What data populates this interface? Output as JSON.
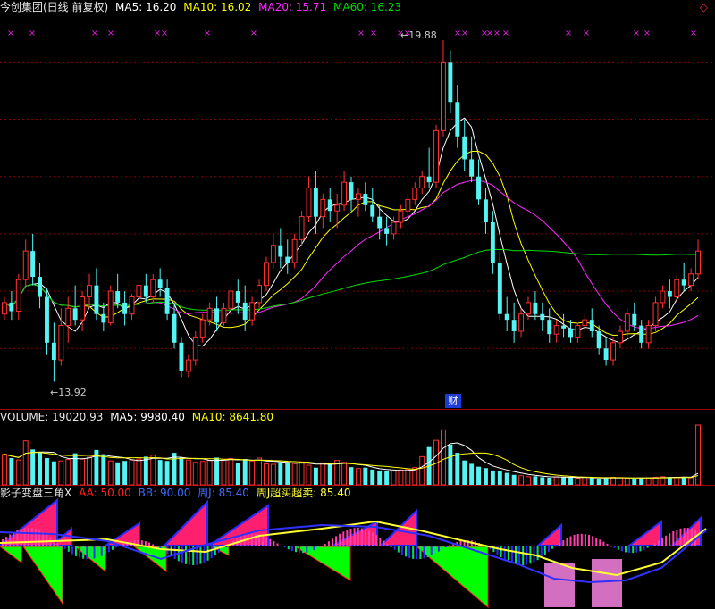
{
  "header_main": {
    "title": "今创集团(日线 前复权)",
    "ma5": "MA5: 16.20",
    "ma10": "MA10: 16.02",
    "ma20": "MA20: 15.71",
    "ma60": "MA60: 16.23",
    "corner_icon": "◇"
  },
  "header_volume": {
    "label": "VOLUME: 19020.93",
    "ma5": "MA5: 9980.40",
    "ma10": "MA10: 8641.80"
  },
  "header_indicator": {
    "title": "影子变盘三角X",
    "aa": "AA: 50.00",
    "bb": "BB: 90.00",
    "zhouj": "周J: 85.40",
    "zhouj_cm": "周J超买超卖: 85.40"
  },
  "annotations": {
    "high": "←19.88",
    "low": "←13.92",
    "cai": "财"
  },
  "colors": {
    "up": "#ff3030",
    "down": "#54f4f4",
    "ma5": "#ffffff",
    "ma10": "#ffff00",
    "ma20": "#ff28ff",
    "ma60": "#00dd00",
    "grid": "#8b0000",
    "tri_pos": "#ff1f6f",
    "tri_neg": "#00ff00",
    "zhouj_line": "#ffff33",
    "blue_line": "#3030ff",
    "pink_box": "#d36fc0"
  },
  "chart_data": [
    {
      "type": "candlestick",
      "title": "今创集团(日线 前复权)",
      "ylim": [
        13.6,
        20.3
      ],
      "gridlines": [
        19.5,
        18.5,
        17.5,
        16.5,
        15.5,
        14.5
      ],
      "high_label": 19.88,
      "low_label": 13.92,
      "ohlc": [
        [
          15.1,
          15.4,
          15.0,
          15.3
        ],
        [
          15.3,
          15.5,
          15.0,
          15.15
        ],
        [
          15.15,
          15.8,
          15.0,
          15.7
        ],
        [
          15.7,
          16.4,
          15.6,
          16.2
        ],
        [
          16.2,
          16.5,
          15.6,
          15.75
        ],
        [
          15.75,
          16.0,
          15.2,
          15.4
        ],
        [
          15.4,
          15.55,
          14.4,
          14.6
        ],
        [
          14.6,
          14.95,
          13.92,
          14.3
        ],
        [
          14.3,
          15.2,
          14.2,
          14.9
        ],
        [
          14.9,
          15.4,
          14.6,
          15.2
        ],
        [
          15.2,
          15.6,
          14.9,
          15.0
        ],
        [
          15.0,
          15.5,
          14.8,
          15.4
        ],
        [
          15.4,
          15.8,
          15.2,
          15.6
        ],
        [
          15.6,
          15.9,
          15.0,
          15.1
        ],
        [
          15.1,
          15.3,
          14.8,
          14.95
        ],
        [
          14.95,
          15.6,
          14.9,
          15.5
        ],
        [
          15.5,
          15.8,
          15.2,
          15.3
        ],
        [
          15.3,
          15.5,
          14.9,
          15.1
        ],
        [
          15.1,
          15.45,
          15.0,
          15.4
        ],
        [
          15.4,
          15.7,
          15.3,
          15.6
        ],
        [
          15.6,
          15.8,
          15.3,
          15.4
        ],
        [
          15.4,
          15.8,
          15.3,
          15.7
        ],
        [
          15.7,
          15.9,
          15.4,
          15.55
        ],
        [
          15.55,
          15.7,
          15.0,
          15.1
        ],
        [
          15.1,
          15.3,
          14.5,
          14.6
        ],
        [
          14.6,
          14.7,
          14.0,
          14.1
        ],
        [
          14.1,
          14.4,
          14.0,
          14.3
        ],
        [
          14.3,
          14.8,
          14.2,
          14.7
        ],
        [
          14.7,
          15.1,
          14.6,
          15.0
        ],
        [
          15.0,
          15.3,
          14.9,
          15.2
        ],
        [
          15.2,
          15.4,
          14.8,
          14.95
        ],
        [
          14.95,
          15.3,
          14.9,
          15.2
        ],
        [
          15.2,
          15.6,
          15.1,
          15.5
        ],
        [
          15.5,
          15.7,
          15.1,
          15.3
        ],
        [
          15.3,
          15.6,
          14.8,
          15.0
        ],
        [
          15.0,
          15.4,
          14.9,
          15.3
        ],
        [
          15.3,
          15.7,
          15.2,
          15.6
        ],
        [
          15.6,
          16.1,
          15.5,
          16.0
        ],
        [
          16.0,
          16.5,
          15.9,
          16.3
        ],
        [
          16.3,
          16.6,
          15.9,
          16.1
        ],
        [
          16.1,
          16.4,
          15.8,
          16.0
        ],
        [
          16.0,
          16.5,
          15.9,
          16.4
        ],
        [
          16.4,
          16.9,
          16.3,
          16.8
        ],
        [
          16.8,
          17.5,
          16.7,
          17.3
        ],
        [
          17.3,
          17.6,
          16.5,
          16.8
        ],
        [
          16.8,
          17.2,
          16.6,
          17.1
        ],
        [
          17.1,
          17.3,
          16.7,
          16.9
        ],
        [
          16.9,
          17.2,
          16.6,
          17.0
        ],
        [
          17.0,
          17.6,
          16.9,
          17.4
        ],
        [
          17.4,
          17.5,
          16.9,
          17.1
        ],
        [
          17.1,
          17.3,
          16.8,
          17.2
        ],
        [
          17.2,
          17.4,
          16.9,
          17.0
        ],
        [
          17.0,
          17.3,
          16.7,
          16.8
        ],
        [
          16.8,
          17.0,
          16.4,
          16.6
        ],
        [
          16.6,
          16.8,
          16.3,
          16.5
        ],
        [
          16.5,
          16.8,
          16.4,
          16.7
        ],
        [
          16.7,
          17.0,
          16.6,
          16.9
        ],
        [
          16.9,
          17.2,
          16.8,
          17.1
        ],
        [
          17.1,
          17.4,
          17.0,
          17.3
        ],
        [
          17.3,
          17.6,
          17.2,
          17.5
        ],
        [
          17.5,
          18.0,
          17.3,
          17.4
        ],
        [
          17.4,
          18.4,
          17.3,
          18.3
        ],
        [
          18.3,
          19.88,
          18.2,
          19.5
        ],
        [
          19.5,
          19.7,
          18.6,
          18.8
        ],
        [
          18.8,
          19.1,
          18.0,
          18.2
        ],
        [
          18.2,
          18.5,
          17.6,
          17.8
        ],
        [
          17.8,
          18.2,
          17.4,
          17.5
        ],
        [
          17.5,
          17.8,
          17.0,
          17.1
        ],
        [
          17.1,
          17.3,
          16.5,
          16.7
        ],
        [
          16.7,
          16.9,
          15.8,
          16.0
        ],
        [
          16.0,
          16.2,
          15.0,
          15.1
        ],
        [
          15.1,
          15.4,
          14.8,
          15.0
        ],
        [
          15.0,
          15.3,
          14.6,
          14.8
        ],
        [
          14.8,
          15.2,
          14.7,
          15.1
        ],
        [
          15.1,
          15.4,
          15.0,
          15.3
        ],
        [
          15.3,
          15.5,
          15.0,
          15.1
        ],
        [
          15.1,
          15.3,
          14.8,
          15.0
        ],
        [
          15.0,
          15.2,
          14.6,
          14.75
        ],
        [
          14.75,
          15.0,
          14.6,
          14.9
        ],
        [
          14.9,
          15.1,
          14.7,
          14.85
        ],
        [
          14.85,
          15.0,
          14.6,
          14.7
        ],
        [
          14.7,
          14.95,
          14.6,
          14.9
        ],
        [
          14.9,
          15.1,
          14.8,
          15.0
        ],
        [
          15.0,
          15.2,
          14.7,
          14.8
        ],
        [
          14.8,
          14.9,
          14.4,
          14.5
        ],
        [
          14.5,
          14.7,
          14.2,
          14.3
        ],
        [
          14.3,
          14.7,
          14.2,
          14.6
        ],
        [
          14.6,
          14.9,
          14.5,
          14.8
        ],
        [
          14.8,
          15.2,
          14.7,
          15.1
        ],
        [
          15.1,
          15.3,
          14.8,
          14.9
        ],
        [
          14.9,
          15.0,
          14.5,
          14.6
        ],
        [
          14.6,
          15.0,
          14.5,
          14.9
        ],
        [
          14.9,
          15.4,
          14.8,
          15.3
        ],
        [
          15.3,
          15.6,
          15.2,
          15.5
        ],
        [
          15.5,
          15.7,
          15.2,
          15.4
        ],
        [
          15.4,
          15.8,
          15.3,
          15.7
        ],
        [
          15.7,
          16.0,
          15.5,
          15.6
        ],
        [
          15.6,
          15.9,
          15.5,
          15.8
        ],
        [
          15.8,
          16.4,
          15.7,
          16.2
        ]
      ],
      "series": [
        {
          "name": "MA5",
          "last": 16.2
        },
        {
          "name": "MA10",
          "last": 16.02
        },
        {
          "name": "MA20",
          "last": 15.71
        },
        {
          "name": "MA60",
          "last": 16.23
        }
      ]
    },
    {
      "type": "bar",
      "title": "VOLUME",
      "values": [
        6400,
        5600,
        5200,
        9200,
        7400,
        6800,
        5600,
        4900,
        5000,
        5300,
        6600,
        5400,
        5800,
        7300,
        6400,
        5000,
        4700,
        5000,
        5200,
        5400,
        5900,
        6200,
        5200,
        5000,
        6700,
        5700,
        5200,
        4700,
        4900,
        5100,
        5700,
        5300,
        5500,
        4500,
        5400,
        5000,
        5600,
        4400,
        4300,
        4700,
        4600,
        4500,
        4800,
        4100,
        3600,
        4600,
        4400,
        5100,
        4700,
        3700,
        3400,
        3600,
        3200,
        3000,
        2800,
        2900,
        3100,
        3300,
        3600,
        5900,
        7900,
        9300,
        11500,
        8400,
        6700,
        5100,
        4400,
        3800,
        3500,
        3000,
        2800,
        2500,
        2100,
        1900,
        1700,
        1800,
        1600,
        1500,
        1700,
        1600,
        1500,
        1400,
        1600,
        1500,
        1300,
        1400,
        1600,
        1500,
        1400,
        1300,
        1500,
        1500,
        1600,
        1700,
        1500,
        1600,
        1700,
        1500,
        19020.93
      ],
      "ylim": [
        0,
        12500
      ],
      "series": [
        {
          "name": "MA5",
          "last": 9980.4
        },
        {
          "name": "MA10",
          "last": 8641.8
        }
      ]
    },
    {
      "type": "area",
      "title": "影子变盘三角X",
      "ylim": [
        -100,
        100
      ],
      "series": [
        {
          "name": "AA",
          "last": 50.0
        },
        {
          "name": "BB",
          "last": 90.0
        },
        {
          "name": "周J",
          "last": 85.4
        },
        {
          "name": "周J超买超卖",
          "last": 85.4
        }
      ]
    }
  ]
}
